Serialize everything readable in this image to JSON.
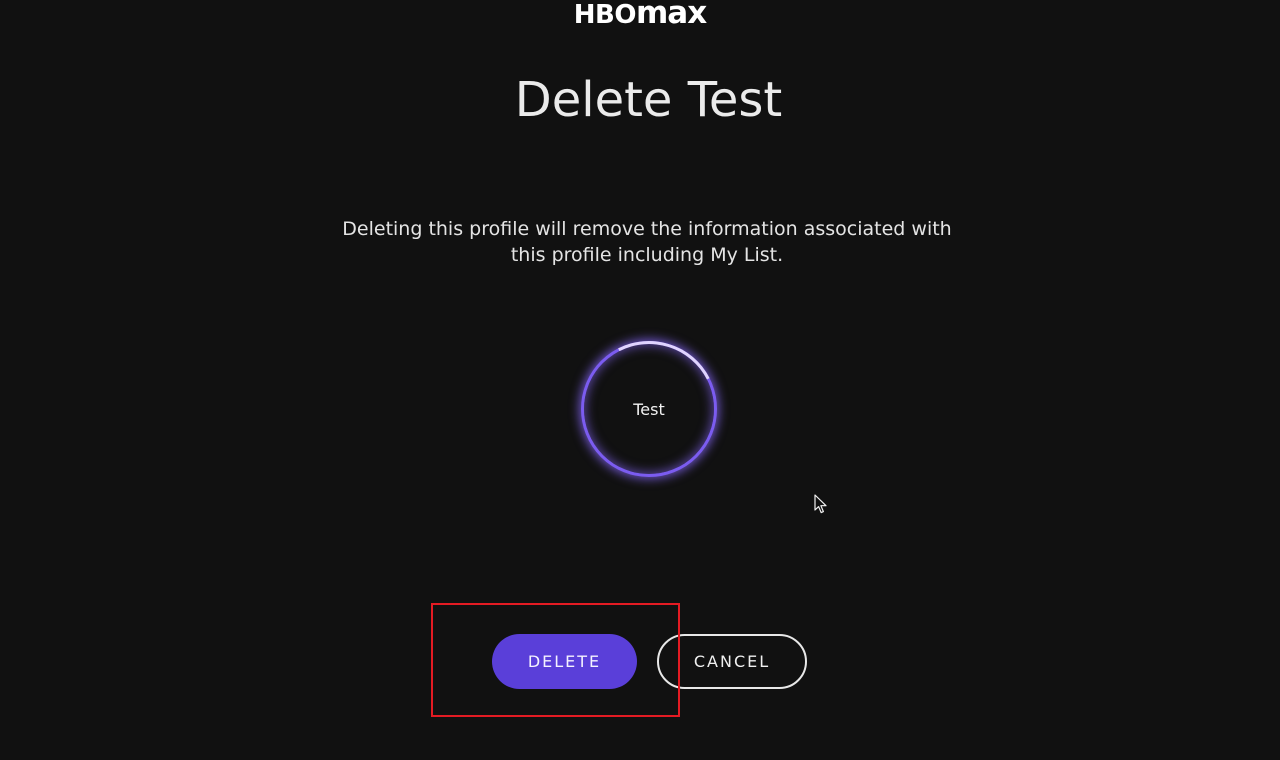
{
  "logo": {
    "hbo": "HBO",
    "max": "max"
  },
  "dialog": {
    "title": "Delete Test",
    "description_line1": "Deleting this profile will remove the information associated with",
    "description_line2": "this profile including My List."
  },
  "profile": {
    "name": "Test",
    "ring_color": "#7b5cf0"
  },
  "actions": {
    "delete_label": "DELETE",
    "cancel_label": "CANCEL",
    "delete_color": "#5a3fd9"
  },
  "annotation": {
    "highlight_color": "#e41b23"
  }
}
